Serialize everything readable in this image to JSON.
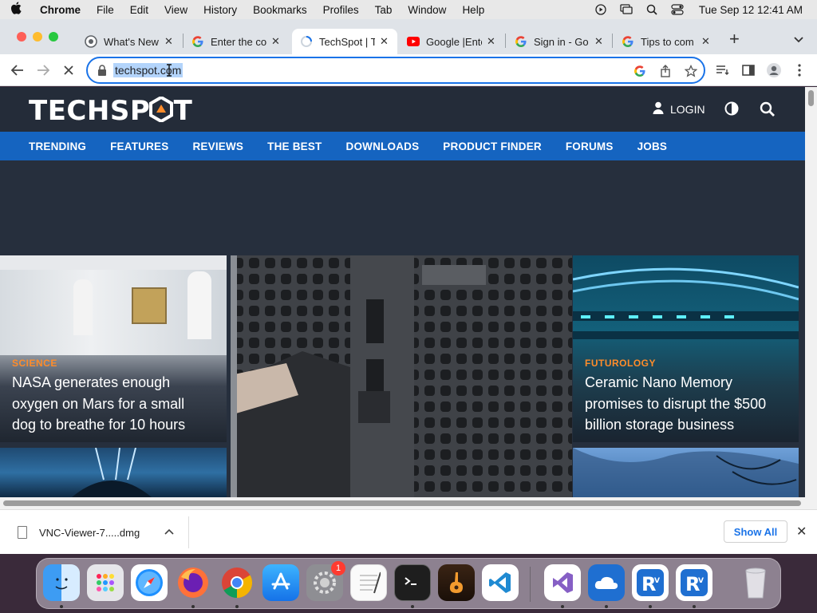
{
  "menubar": {
    "app_name": "Chrome",
    "items": [
      "File",
      "Edit",
      "View",
      "History",
      "Bookmarks",
      "Profiles",
      "Tab",
      "Window",
      "Help"
    ],
    "clock": "Tue Sep 12  12:41 AM"
  },
  "tabs": [
    {
      "title": "What's New",
      "icon": "chrome-icon"
    },
    {
      "title": "Enter the co",
      "icon": "google-icon"
    },
    {
      "title": "TechSpot | T",
      "icon": "loading-spinner-icon",
      "active": true
    },
    {
      "title": "Google |Ente",
      "icon": "youtube-icon"
    },
    {
      "title": "Sign in - Go",
      "icon": "google-icon"
    },
    {
      "title": "Tips to com",
      "icon": "google-icon"
    }
  ],
  "toolbar": {
    "url": "techspot.com"
  },
  "site": {
    "logo_text": "TECHSPOT",
    "login_label": "LOGIN",
    "nav": [
      "TRENDING",
      "FEATURES",
      "REVIEWS",
      "THE BEST",
      "DOWNLOADS",
      "PRODUCT FINDER",
      "FORUMS",
      "JOBS"
    ],
    "articles": [
      {
        "category": "SCIENCE",
        "headline": "NASA generates enough oxygen on Mars for a small dog to breathe for 10 hours"
      },
      {
        "category": "FUTUROLOGY",
        "headline": "Ceramic Nano Memory promises to disrupt the $500 billion storage business"
      }
    ]
  },
  "download_bar": {
    "file_name": "VNC-Viewer-7.....dmg",
    "show_all": "Show All"
  },
  "dock": {
    "badge_count": "1",
    "apps": [
      "finder",
      "launchpad",
      "safari",
      "firefox",
      "chrome",
      "app-store",
      "system-settings",
      "textedit",
      "terminal",
      "garageband",
      "vscode",
      "visual-studio",
      "onedrive",
      "vnc-viewer",
      "vnc-viewer-2",
      "trash"
    ]
  },
  "colors": {
    "accent_orange": "#ff8c2a",
    "nav_blue": "#1564c0",
    "header_dark": "#242c39",
    "chrome_blue": "#1a73e8"
  }
}
